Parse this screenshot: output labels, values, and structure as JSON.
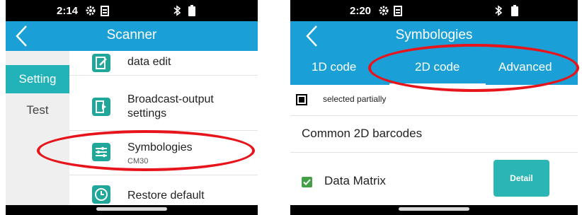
{
  "colors": {
    "app_bar": "#1aa0d6",
    "active_tab": "#21b3b7",
    "icon_teal": "#21a79a",
    "detail_button": "#2bb5b5",
    "checkbox_green": "#43a047",
    "annotation_red": "#e8141c"
  },
  "left": {
    "status": {
      "time": "2:14",
      "icons": [
        "gear-icon",
        "clipboard-icon",
        "bluetooth-icon",
        "battery-icon"
      ]
    },
    "app_bar": {
      "title": "Scanner"
    },
    "sidebar": {
      "items": [
        {
          "label": "Setting",
          "active": true
        },
        {
          "label": "Test",
          "active": false
        }
      ]
    },
    "list": [
      {
        "label": "data edit",
        "icon": "edit-icon"
      },
      {
        "label": "Broadcast-output\nsettings",
        "icon": "broadcast-icon"
      },
      {
        "label": "Symbologies",
        "sub": "CM30",
        "icon": "sliders-icon"
      },
      {
        "label": "Restore default",
        "icon": "clock-icon"
      }
    ]
  },
  "right": {
    "status": {
      "time": "2:20",
      "icons": [
        "gear-icon",
        "clipboard-icon",
        "bluetooth-icon",
        "battery-icon"
      ]
    },
    "app_bar": {
      "title": "Symbologies"
    },
    "tabs": [
      {
        "label": "1D code",
        "active": false
      },
      {
        "label": "2D code",
        "active": true
      },
      {
        "label": "Advanced",
        "active": false
      }
    ],
    "select_all_text": "selected partially",
    "section_heading": "Common 2D barcodes",
    "items": [
      {
        "label": "Data Matrix",
        "checked": true,
        "button": "Detail"
      }
    ]
  }
}
